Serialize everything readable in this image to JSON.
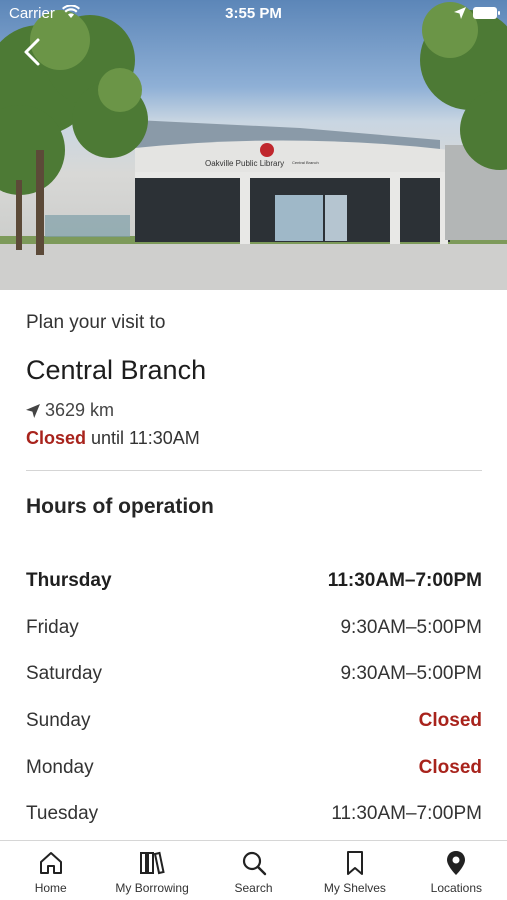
{
  "status_bar": {
    "carrier": "Carrier",
    "time": "3:55 PM"
  },
  "hero": {
    "sign_text": "Oakville Public Library",
    "sign_sub": "Central Branch"
  },
  "visit": {
    "intro": "Plan your visit to",
    "branch_name": "Central Branch",
    "distance": "3629 km",
    "status_word": "Closed",
    "status_rest": " until 11:30AM"
  },
  "hours": {
    "title": "Hours of operation",
    "rows": [
      {
        "day": "Thursday",
        "time": "11:30AM–7:00PM"
      },
      {
        "day": "Friday",
        "time": "9:30AM–5:00PM"
      },
      {
        "day": "Saturday",
        "time": "9:30AM–5:00PM"
      },
      {
        "day": "Sunday",
        "time": "Closed"
      },
      {
        "day": "Monday",
        "time": "Closed"
      },
      {
        "day": "Tuesday",
        "time": "11:30AM–7:00PM"
      }
    ]
  },
  "tabbar": {
    "home": "Home",
    "borrowing": "My Borrowing",
    "search": "Search",
    "shelves": "My Shelves",
    "locations": "Locations"
  },
  "colors": {
    "closed": "#a8231c"
  }
}
